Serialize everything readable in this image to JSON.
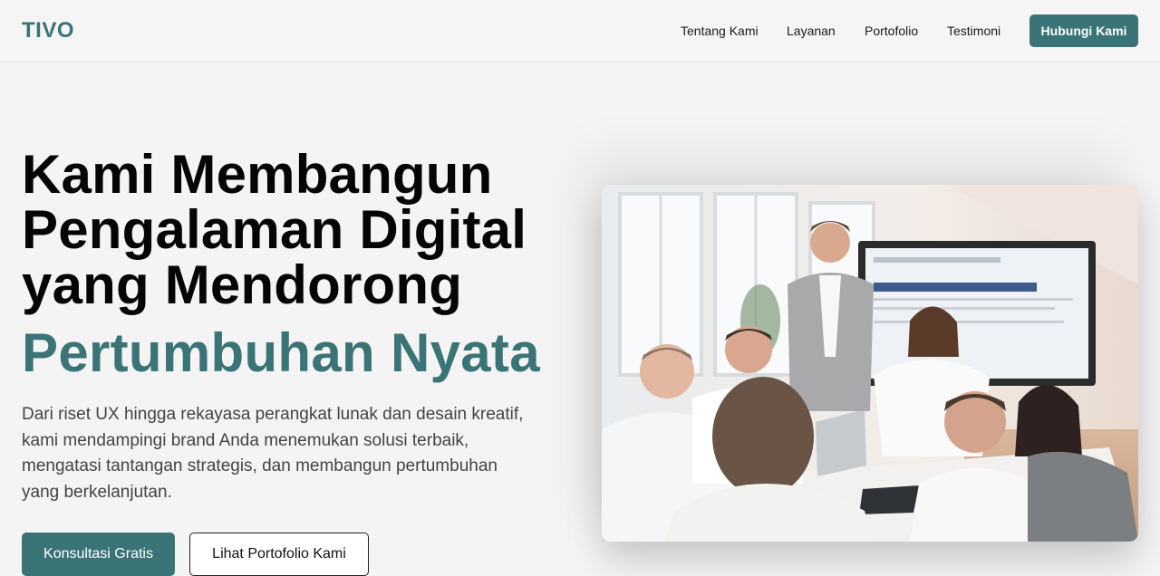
{
  "brand": {
    "logo": "TIVO",
    "accent_color": "#3b7476"
  },
  "nav": {
    "items": [
      {
        "label": "Tentang Kami"
      },
      {
        "label": "Layanan"
      },
      {
        "label": "Portofolio"
      },
      {
        "label": "Testimoni"
      }
    ],
    "cta_label": "Hubungi Kami"
  },
  "hero": {
    "title_lines": [
      "Kami Membangun",
      "Pengalaman Digital",
      "yang Mendorong"
    ],
    "title_accent": "Pertumbuhan Nyata",
    "description_lines": [
      "Dari riset UX hingga rekayasa perangkat lunak dan desain kreatif,",
      "kami mendampingi brand Anda menemukan solusi terbaik,",
      "mengatasi tantangan strategis, dan membangun pertumbuhan",
      "yang berkelanjutan."
    ],
    "primary_button": "Konsultasi Gratis",
    "secondary_button": "Lihat Portofolio Kami"
  }
}
